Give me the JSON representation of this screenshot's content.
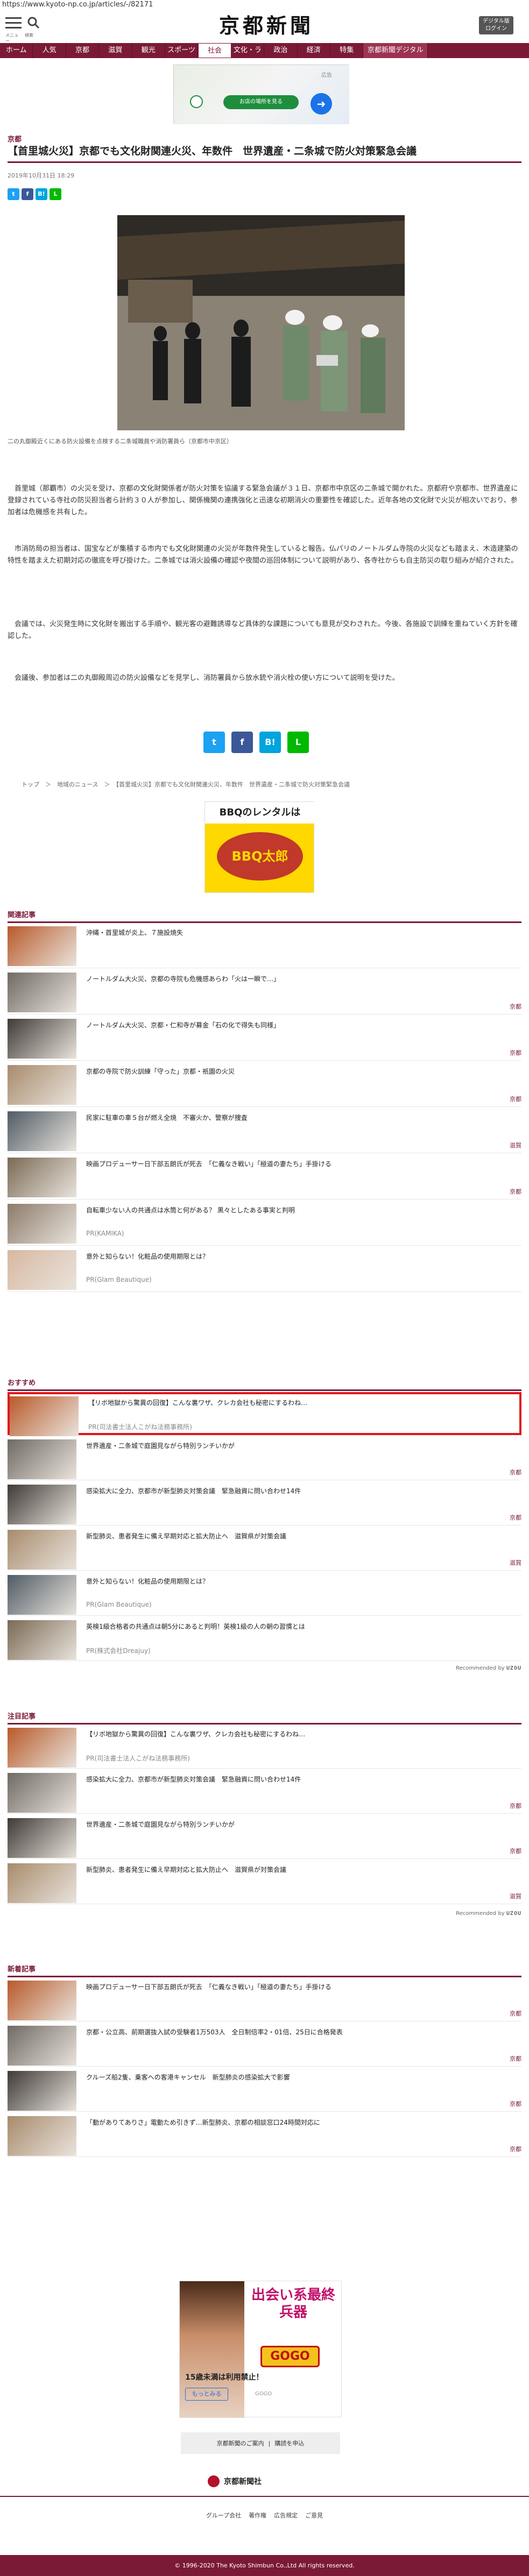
{
  "url": "https://www.kyoto-np.co.jp/articles/-/82171",
  "header": {
    "menu_label": "メニュー",
    "search_label": "検索",
    "logo": "京都新聞",
    "digital_label": "デジタル版\nログイン"
  },
  "nav": [
    "ホーム",
    "人気",
    "京都",
    "滋賀",
    "観光",
    "スポーツ",
    "社会",
    "文化・ライフ",
    "政治",
    "経済",
    "特集",
    "京都新聞デジタル"
  ],
  "ad_top": {
    "label": "広告",
    "button": "お店の場所を見る"
  },
  "article": {
    "category": "京都",
    "title": "【首里城火災】京都でも文化財関連火災、年数件　世界遺産・二条城で防火対策緊急会議",
    "date": "2019年10月31日 18:29",
    "caption": "二の丸御殿近くにある防火設備を点検する二条城職員や消防署員ら（京都市中京区）",
    "paragraphs": [
      "　首里城（那覇市）の火災を受け、京都の文化財関係者が防火対策を協議する緊急会議が３１日、京都市中京区の二条城で開かれた。京都府や京都市、世界遺産に登録されている寺社の防災担当者ら計約３０人が参加し、関係機関の連携強化と迅速な初期消火の重要性を確認した。近年各地の文化財で火災が相次いでおり、参加者は危機感を共有した。",
      "　市消防局の担当者は、国宝などが集積する市内でも文化財関連の火災が年数件発生していると報告。仏パリのノートルダム寺院の火災なども踏まえ、木造建築の特性を踏まえた初期対応の徹底を呼び掛けた。二条城では消火設備の確認や夜間の巡回体制について説明があり、各寺社からも自主防災の取り組みが紹介された。",
      "　会議では、火災発生時に文化財を搬出する手順や、観光客の避難誘導など具体的な課題についても意見が交わされた。今後、各施設で訓練を重ねていく方針を確認した。",
      "　会議後、参加者は二の丸御殿周辺の防火設備などを見学し、消防署員から放水銃や消火栓の使い方について説明を受けた。"
    ]
  },
  "sns_labels": [
    "t",
    "f",
    "B!",
    "L"
  ],
  "breadcrumb": "トップ　＞　地域のニュース　＞　【首里城火災】京都でも文化財関連火災、年数件　世界遺産・二条城で防火対策緊急会議",
  "bbq_ad": {
    "line1": "BBQのレンタルは",
    "line2": "BBQ太郎"
  },
  "related": {
    "heading": "関連記事",
    "items": [
      {
        "title": "沖縄・首里城が炎上、７施設焼失",
        "src": "",
        "tag": ""
      },
      {
        "title": "ノートルダム大火災、京都の寺院も危機感あらわ「火は一瞬で…」",
        "src": "",
        "tag": "京都"
      },
      {
        "title": "ノートルダム大火災、京都・仁和寺が募金「石の化で得失も同様」",
        "src": "",
        "tag": "京都"
      },
      {
        "title": "京都の寺院で防火訓練「守った」京都・祇園の火災",
        "src": "",
        "tag": "京都"
      },
      {
        "title": "民家に駐車の車５台が燃え全焼　不審火か、警察が捜査",
        "src": "",
        "tag": "滋賀"
      },
      {
        "title": "映画プロデューサー日下部五朗氏が死去　「仁義なき戦い」「極道の妻たち」手掛ける",
        "src": "",
        "tag": "京都"
      },
      {
        "title": "自転車少ない人の共通点は水筒と何がある？ 黒々としたある事実と判明",
        "src": "PR(KAMIKA)",
        "tag": ""
      },
      {
        "title": "意外と知らない！化粧品の使用期限とは？",
        "src": "PR(Glam Beautique)",
        "tag": ""
      }
    ]
  },
  "recommend": {
    "heading": "おすすめ",
    "items": [
      {
        "title": "【リボ地獄から驚異の回復】こんな裏ワザ、クレカ会社も秘密にするわね…",
        "src": "PR(司法書士法人こがね法務事務所)",
        "tag": "",
        "highlight": true
      },
      {
        "title": "世界遺産・二条城で庭園見ながら特別ランチいかが",
        "src": "",
        "tag": "京都"
      },
      {
        "title": "感染拡大に全力、京都市が新型肺炎対策会議　緊急融資に問い合わせ14件",
        "src": "",
        "tag": "京都"
      },
      {
        "title": "新型肺炎、患者発生に備え早期対応と拡大防止へ　滋賀県が対策会議",
        "src": "",
        "tag": "滋賀"
      },
      {
        "title": "意外と知らない！化粧品の使用期限とは？",
        "src": "PR(Glam Beautique)",
        "tag": ""
      },
      {
        "title": "英検1級合格者の共通点は朝5分にあると判明！英検1級の人の朝の習慣とは",
        "src": "PR(株式会社Dreajuy)",
        "tag": ""
      }
    ],
    "rec_label": "Recommended by",
    "rec_brand": "UZOU"
  },
  "attention": {
    "heading": "注目記事",
    "items": [
      {
        "title": "【リボ地獄から驚異の回復】こんな裏ワザ、クレカ会社も秘密にするわね…",
        "src": "PR(司法書士法人こがね法務事務所)",
        "tag": ""
      },
      {
        "title": "感染拡大に全力、京都市が新型肺炎対策会議　緊急融資に問い合わせ14件",
        "src": "",
        "tag": "京都"
      },
      {
        "title": "世界遺産・二条城で庭園見ながら特別ランチいかが",
        "src": "",
        "tag": "京都"
      },
      {
        "title": "新型肺炎、患者発生に備え早期対応と拡大防止へ　滋賀県が対策会議",
        "src": "",
        "tag": "滋賀"
      }
    ],
    "rec_label": "Recommended by",
    "rec_brand": "UZOU"
  },
  "latest": {
    "heading": "新着記事",
    "items": [
      {
        "title": "映画プロデューサー日下部五朗氏が死去　「仁義なき戦い」「極道の妻たち」手掛ける",
        "src": "",
        "tag": "京都"
      },
      {
        "title": "京都・公立高、前期選抜入試の受験者1万503人　全日制倍率2・01倍、25日に合格発表",
        "src": "",
        "tag": "京都"
      },
      {
        "title": "クルーズ船2隻、乗客への客港キャンセル　新型肺炎の感染拡大で影響",
        "src": "",
        "tag": "京都"
      },
      {
        "title": "「動がありてありさ」電動ため引きず…新型肺炎、京都の相談窓口24時間対応に",
        "src": "",
        "tag": "京都"
      }
    ]
  },
  "ad_bottom": {
    "title": "出会い系最終兵器",
    "badge": "GOGO",
    "caption": "15歳未満は利用禁止！",
    "more": "もっとみる",
    "sponsor": "GOGO"
  },
  "footer_links_box": [
    "京都新聞のご案内",
    "購読を申込"
  ],
  "brand": "京都新聞社",
  "footer_links": [
    "グループ会社",
    "著作権",
    "広告規定",
    "ご意見"
  ],
  "copyright": "© 1996-2020 The Kyoto Shimbun Co.,Ltd All rights reserved."
}
